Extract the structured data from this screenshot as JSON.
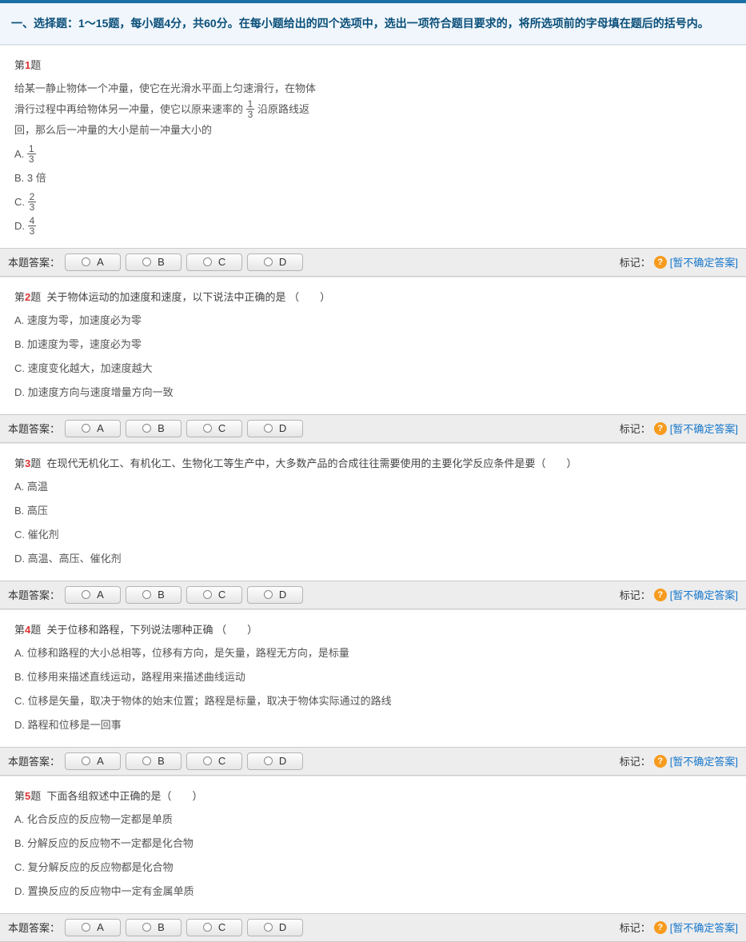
{
  "instructions": "一、选择题：1～15题，每小题4分，共60分。在每小题给出的四个选项中，选出一项符合题目要求的，将所选项前的字母填在题后的括号内。",
  "answer_label": "本题答案：",
  "mark_label": "标记：",
  "unsure_label": "[暂不确定答案]",
  "choices": [
    "A",
    "B",
    "C",
    "D"
  ],
  "questions": [
    {
      "num": "1",
      "prefix": "第",
      "suffix": "题",
      "stem_lines": [
        "给某一静止物体一个冲量，使它在光滑水平面上匀速滑行，在物体",
        "滑行过程中再给物体另一冲量，使它以原来速率的",
        "沿原路线返",
        "回，那么后一冲量的大小是前一冲量大小的"
      ],
      "stem_frac": {
        "n": "1",
        "d": "3"
      },
      "options": [
        {
          "label": "A.",
          "frac": {
            "n": "1",
            "d": "3"
          }
        },
        {
          "label": "B.",
          "text": "3 倍"
        },
        {
          "label": "C.",
          "frac": {
            "n": "2",
            "d": "3"
          }
        },
        {
          "label": "D.",
          "frac": {
            "n": "4",
            "d": "3"
          }
        }
      ]
    },
    {
      "num": "2",
      "prefix": "第",
      "suffix": "题",
      "stem": "关于物体运动的加速度和速度，以下说法中正确的是 （　　）",
      "options": [
        {
          "label": "A.",
          "text": "速度为零，加速度必为零"
        },
        {
          "label": "B.",
          "text": "加速度为零，速度必为零"
        },
        {
          "label": "C.",
          "text": "速度变化越大，加速度越大"
        },
        {
          "label": "D.",
          "text": "加速度方向与速度增量方向一致"
        }
      ]
    },
    {
      "num": "3",
      "prefix": "第",
      "suffix": "题",
      "stem": "在现代无机化工、有机化工、生物化工等生产中，大多数产品的合成往往需要使用的主要化学反应条件是要（　　）",
      "options": [
        {
          "label": "A.",
          "text": "高温"
        },
        {
          "label": "B.",
          "text": "高压"
        },
        {
          "label": "C.",
          "text": "催化剂"
        },
        {
          "label": "D.",
          "text": "高温、高压、催化剂"
        }
      ]
    },
    {
      "num": "4",
      "prefix": "第",
      "suffix": "题",
      "stem": "关于位移和路程，下列说法哪种正确 （　　）",
      "options": [
        {
          "label": "A.",
          "text": "位移和路程的大小总相等，位移有方向，是矢量，路程无方向，是标量"
        },
        {
          "label": "B.",
          "text": "位移用来描述直线运动，路程用来描述曲线运动"
        },
        {
          "label": "C.",
          "text": "位移是矢量，取决于物体的始末位置；路程是标量，取决于物体实际通过的路线"
        },
        {
          "label": "D.",
          "text": "路程和位移是一回事"
        }
      ]
    },
    {
      "num": "5",
      "prefix": "第",
      "suffix": "题",
      "stem": "下面各组叙述中正确的是（　　）",
      "options": [
        {
          "label": "A.",
          "text": "化合反应的反应物一定都是单质"
        },
        {
          "label": "B.",
          "text": "分解反应的反应物不一定都是化合物"
        },
        {
          "label": "C.",
          "text": "复分解反应的反应物都是化合物"
        },
        {
          "label": "D.",
          "text": "置换反应的反应物中一定有金属单质"
        }
      ]
    }
  ]
}
